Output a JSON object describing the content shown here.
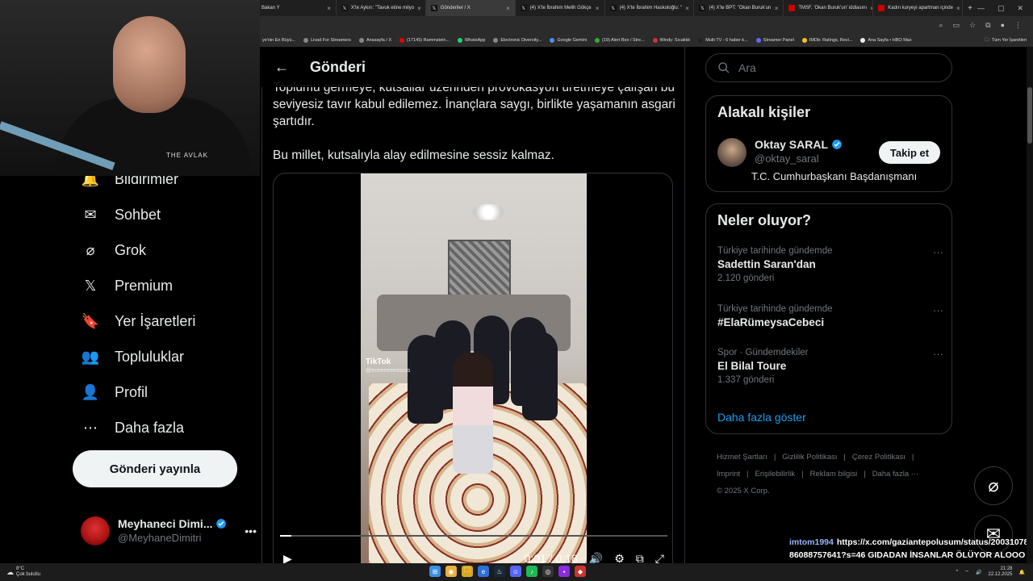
{
  "browser": {
    "tabs": [
      {
        "label": "Bakan Y",
        "active": false
      },
      {
        "label": "X'te Aykırı: \"Tavuk etine milyo",
        "active": false
      },
      {
        "label": "Gönderiler / X",
        "active": true
      },
      {
        "label": "(4) X'te İbrahim Melih Gökçe",
        "active": false
      },
      {
        "label": "(4) X'te İbrahim Haskoloğlu: \"",
        "active": false
      },
      {
        "label": "(4) X'te BPT: \"Okan Buruk'un",
        "active": false
      },
      {
        "label": "TMSF, 'Okan Buruk'un' iddiasını",
        "active": false
      },
      {
        "label": "Kadın kuryeyi apartman içinde",
        "active": false
      }
    ],
    "new_tab": "+",
    "bookmarks": [
      "ye'nin En Büyü...",
      "Livad For Streamers",
      "Anasayfa / X",
      "(17145) Rammstein...",
      "WhatsApp",
      "Electronic Diversity...",
      "Google Gemini",
      "(19) Alert Box / Stre...",
      "Windy: Sıcaklık",
      "Multi TV - 6 haber k...",
      "Streamer Panel",
      "IMDb: Ratings, Revi...",
      "Ana Sayfa • HBO Max"
    ],
    "all_bookmarks": "Tüm Yer İşaretleri"
  },
  "webcam": {
    "logo_text": "THE AVLAK"
  },
  "nav": {
    "items": [
      {
        "label": "Bildirimler",
        "icon": "bell-icon",
        "glyph": "🔔"
      },
      {
        "label": "Sohbet",
        "icon": "mail-icon",
        "glyph": "✉"
      },
      {
        "label": "Grok",
        "icon": "grok-icon",
        "glyph": "⌀"
      },
      {
        "label": "Premium",
        "icon": "x-logo-icon",
        "glyph": "𝕏"
      },
      {
        "label": "Yer İşaretleri",
        "icon": "bookmark-icon",
        "glyph": "🔖"
      },
      {
        "label": "Topluluklar",
        "icon": "communities-icon",
        "glyph": "👥"
      },
      {
        "label": "Profil",
        "icon": "profile-icon",
        "glyph": "👤"
      },
      {
        "label": "Daha fazla",
        "icon": "more-circle-icon",
        "glyph": "⋯"
      }
    ],
    "post_button": "Gönderi yayınla"
  },
  "account": {
    "name": "Meyhaneci Dimi...",
    "handle": "@MeyhaneDimitri",
    "more": "•••"
  },
  "main": {
    "title": "Gönderi",
    "paragraphs": [
      "Toplumu germeye, kutsallar üzerinden provokasyon üretmeye çalışan bu seviyesiz tavır kabul edilemez. İnançlara saygı, birlikte yaşamanın asgari şartıdır.",
      "Bu millet, kutsalıyla alay edilmesine sessiz kalmaz."
    ],
    "video": {
      "watermark": "TikTok",
      "watermark_user": "@eceeeeeesssss",
      "time": "0:01 / 0:18",
      "progress": 0.03
    }
  },
  "right": {
    "search_placeholder": "Ara",
    "related_title": "Alakalı kişiler",
    "related_person": {
      "name": "Oktay SARAL",
      "handle": "@oktay_saral",
      "bio": "T.C. Cumhurbaşkanı Başdanışmanı",
      "follow": "Takip et"
    },
    "trends_title": "Neler oluyor?",
    "trends": [
      {
        "context": "Türkiye tarihinde gündemde",
        "name": "Sadettin Saran'dan",
        "count": "2.120 gönderi"
      },
      {
        "context": "Türkiye tarihinde gündemde",
        "name": "#ElaRümeysaCebeci",
        "count": ""
      },
      {
        "context": "Spor · Gündemdekiler",
        "name": "El Bilal Toure",
        "count": "1.337 gönderi"
      }
    ],
    "trend_more": "···",
    "show_more": "Daha fazla göster",
    "footer": [
      "Hizmet Şartları",
      "|",
      "Gizlilik Politikası",
      "|",
      "Çerez Politikası",
      "|",
      "Imprint",
      "|",
      "Erişilebilirlik",
      "|",
      "Reklam bilgisi",
      "|",
      "Daha fazla ···",
      "© 2025 X Corp."
    ]
  },
  "chat": {
    "user": "imtom1994",
    "message": "https://x.com/gaziantepolusum/status/2003107886088757641?s=46 GIDADAN İNSANLAR ÖLÜYOR ALOOOO"
  },
  "taskbar": {
    "temp": "8°C",
    "weather": "Çok bulutlu",
    "time": "21:28",
    "date": "22.12.2025"
  },
  "colors": {
    "accent": "#1d9bf0",
    "verified": "#1d9bf0",
    "background": "#000000",
    "border": "#2f3336"
  }
}
